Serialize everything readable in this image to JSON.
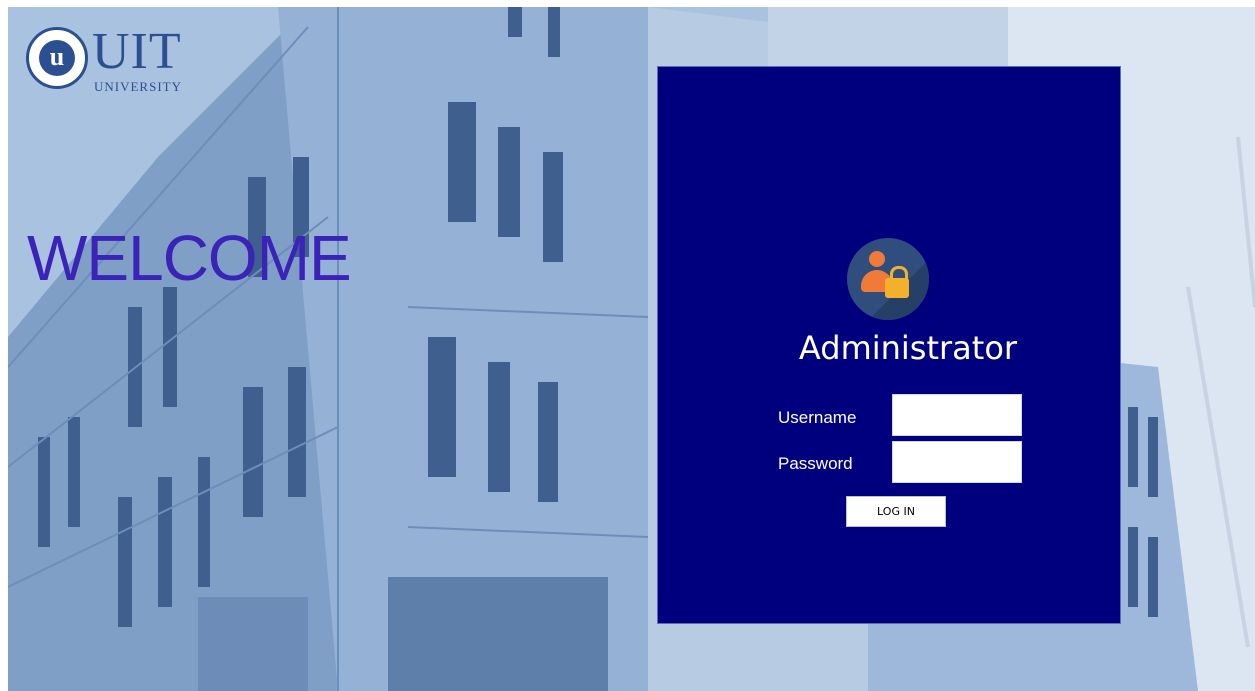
{
  "logo": {
    "seal_letter": "u",
    "name": "UIT",
    "subtitle": "UNIVERSITY"
  },
  "hero": {
    "welcome": "WELCOME"
  },
  "login_panel": {
    "title": "Administrator",
    "username_label": "Username",
    "username_value": "",
    "password_label": "Password",
    "password_value": "",
    "login_button": "LOG IN",
    "icon": "admin-user-lock-icon"
  },
  "colors": {
    "panel_bg": "#00007f",
    "welcome_text": "#3a23b6",
    "brand_blue": "#2c4f92",
    "avatar_person": "#f07a3a",
    "avatar_lock": "#f3b12b"
  }
}
